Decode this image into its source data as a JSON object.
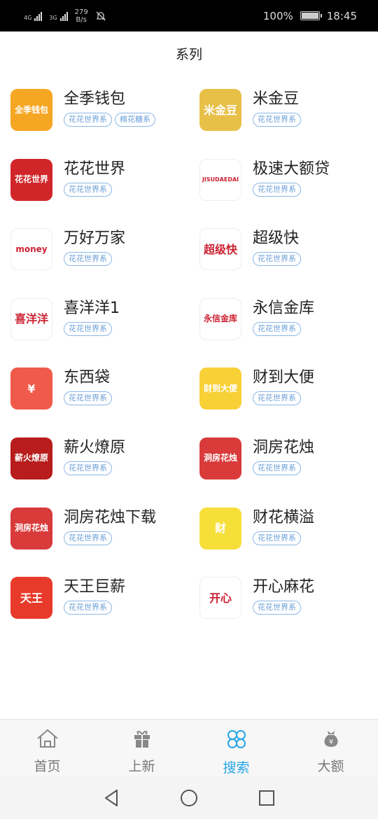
{
  "status_bar": {
    "sim1": "4G",
    "sim2": "3G",
    "speed_value": "279",
    "speed_unit": "B/s",
    "battery": "100%",
    "time": "18:45"
  },
  "page": {
    "title": "系列"
  },
  "apps": [
    {
      "name": "全季钱包",
      "tags": [
        "花花世界系",
        "棉花糖系"
      ],
      "icon": "wallet-icon",
      "icon_text": "全季钱包",
      "bg": "#f5a623"
    },
    {
      "name": "米金豆",
      "tags": [
        "花花世界系"
      ],
      "icon": "gold-bean-icon",
      "icon_text": "米金豆",
      "bg": "#e8c048"
    },
    {
      "name": "花花世界",
      "tags": [
        "花花世界系"
      ],
      "icon": "couple-icon",
      "icon_text": "花花世界",
      "bg": "#d0262a"
    },
    {
      "name": "极速大额贷",
      "tags": [
        "花花世界系"
      ],
      "icon": "loan-logo-icon",
      "icon_text": "JISUDAEDAI",
      "bg": "#ffffff"
    },
    {
      "name": "万好万家",
      "tags": [
        "花花世界系"
      ],
      "icon": "house-money-icon",
      "icon_text": "money",
      "bg": "#ffffff"
    },
    {
      "name": "超级快",
      "tags": [
        "花花世界系"
      ],
      "icon": "lightning-icon",
      "icon_text": "超级快",
      "bg": "#ffffff"
    },
    {
      "name": "喜洋洋1",
      "tags": [
        "花花世界系"
      ],
      "icon": "sheep-icon",
      "icon_text": "喜洋洋",
      "bg": "#ffffff"
    },
    {
      "name": "永信金库",
      "tags": [
        "花花世界系"
      ],
      "icon": "lotus-logo-icon",
      "icon_text": "永信金库",
      "bg": "#ffffff"
    },
    {
      "name": "东西袋",
      "tags": [
        "花花世界系"
      ],
      "icon": "money-bag-icon",
      "icon_text": "¥",
      "bg": "#f05a4a"
    },
    {
      "name": "财到大便",
      "tags": [
        "花花世界系"
      ],
      "icon": "cartoon-coin-icon",
      "icon_text": "财到大便",
      "bg": "#f7d136"
    },
    {
      "name": "薪火燎原",
      "tags": [
        "花花世界系"
      ],
      "icon": "calligraphy-icon",
      "icon_text": "薪火燎原",
      "bg": "#b81c1c"
    },
    {
      "name": "洞房花烛",
      "tags": [
        "花花世界系"
      ],
      "icon": "wedding-icon",
      "icon_text": "洞房花烛",
      "bg": "#d93a3a"
    },
    {
      "name": "洞房花烛下载",
      "tags": [
        "花花世界系"
      ],
      "icon": "wedding-icon",
      "icon_text": "洞房花烛",
      "bg": "#d93a3a"
    },
    {
      "name": "财花横溢",
      "tags": [
        "花花世界系"
      ],
      "icon": "cai-character-icon",
      "icon_text": "财",
      "bg": "#f7df3a"
    },
    {
      "name": "天王巨薪",
      "tags": [
        "花花世界系"
      ],
      "icon": "car-cartoon-icon",
      "icon_text": "天王",
      "bg": "#e83a2a"
    },
    {
      "name": "开心麻花",
      "tags": [
        "花花世界系"
      ],
      "icon": "god-of-wealth-icon",
      "icon_text": "开心",
      "bg": "#ffffff"
    }
  ],
  "tabbar": {
    "tabs": [
      {
        "label": "首页",
        "icon": "home-icon"
      },
      {
        "label": "上新",
        "icon": "gift-icon"
      },
      {
        "label": "搜索",
        "icon": "clover-icon",
        "active": true
      },
      {
        "label": "大额",
        "icon": "money-bag-icon"
      }
    ],
    "active_color": "#27a6e6"
  },
  "navbar": {
    "buttons": [
      "back",
      "home",
      "recents"
    ]
  }
}
